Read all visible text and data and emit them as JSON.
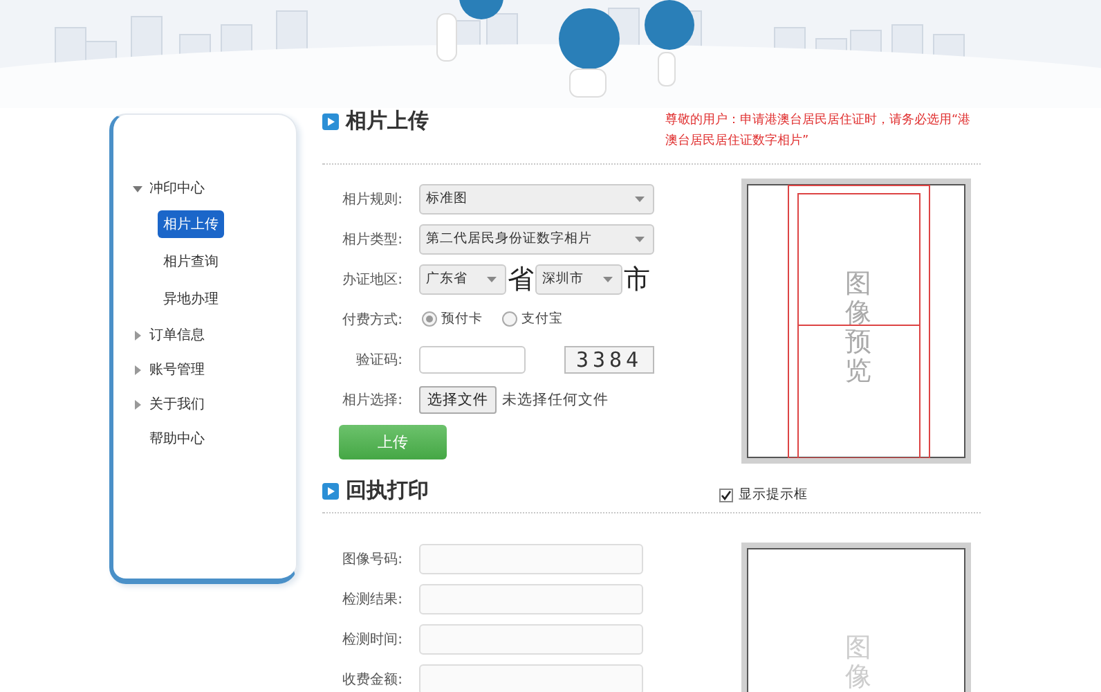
{
  "sidebar": {
    "items": [
      {
        "label": "冲印中心",
        "expanded": true,
        "children": [
          {
            "label": "相片上传",
            "selected": true
          },
          {
            "label": "相片查询",
            "selected": false
          },
          {
            "label": "异地办理",
            "selected": false
          }
        ]
      },
      {
        "label": "订单信息",
        "expanded": false
      },
      {
        "label": "账号管理",
        "expanded": false
      },
      {
        "label": "关于我们",
        "expanded": false
      },
      {
        "label": "帮助中心"
      }
    ]
  },
  "upload": {
    "title": "相片上传",
    "notice": "尊敬的用户：申请港澳台居民居住证时，请务必选用“港澳台居民居住证数字相片”",
    "fields": [
      {
        "kind": "select",
        "label": "相片规则:",
        "value": "标准图"
      },
      {
        "kind": "select",
        "label": "相片类型:",
        "value": "第二代居民身份证数字相片"
      },
      {
        "kind": "region",
        "label": "办证地区:",
        "province": "广东省",
        "province_unit": "省",
        "city": "深圳市",
        "city_unit": "市"
      },
      {
        "kind": "radio",
        "label": "付费方式:",
        "options": [
          {
            "label": "预付卡",
            "selected": true
          },
          {
            "label": "支付宝",
            "selected": false
          }
        ]
      },
      {
        "kind": "captcha",
        "label": "验证码:",
        "captcha": "3384"
      },
      {
        "kind": "file",
        "label": "相片选择:",
        "button": "选择文件",
        "status": "未选择任何文件"
      }
    ],
    "submit": "上传",
    "preview": {
      "text": "图像预览"
    },
    "show_guides": {
      "label": "显示提示框",
      "checked": true
    }
  },
  "receipt": {
    "title": "回执打印",
    "fields": [
      {
        "label": "图像号码:"
      },
      {
        "label": "检测结果:"
      },
      {
        "label": "检测时间:"
      },
      {
        "label": "收费金额:"
      }
    ],
    "preview": {
      "text": "图像"
    }
  }
}
